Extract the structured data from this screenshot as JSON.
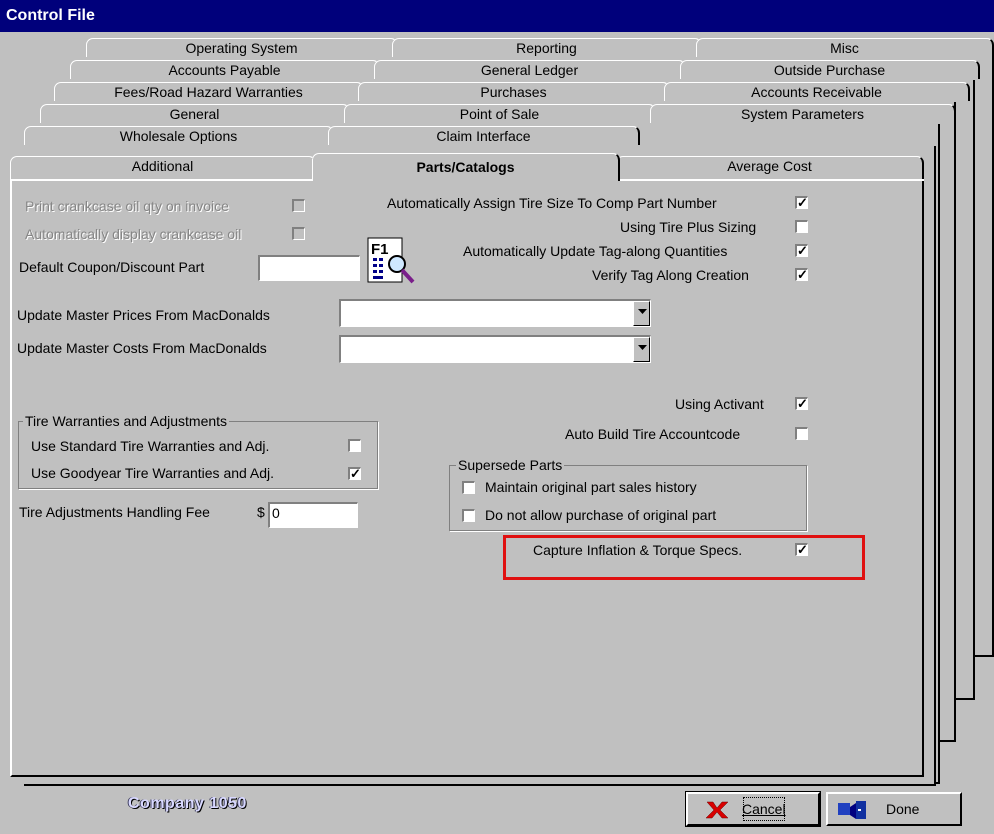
{
  "window": {
    "title": "Control File"
  },
  "tabs": {
    "row1": [
      "Operating System",
      "Reporting",
      "Misc"
    ],
    "row2": [
      "Accounts Payable",
      "General Ledger",
      "Outside Purchase"
    ],
    "row3": [
      "Fees/Road Hazard Warranties",
      "Purchases",
      "Accounts Receivable"
    ],
    "row4": [
      "General",
      "Point of Sale",
      "System Parameters"
    ],
    "row5": [
      "Wholesale Options",
      "Claim Interface"
    ],
    "row6": [
      "Additional",
      "Parts/Catalogs",
      "Average Cost"
    ],
    "selected": "Parts/Catalogs"
  },
  "left": {
    "print_crankcase": {
      "label": "Print crankcase oil qty on invoice",
      "checked": false,
      "disabled": true
    },
    "auto_display_crankcase": {
      "label": "Automatically display crankcase oil",
      "checked": false,
      "disabled": true
    },
    "default_coupon": {
      "label": "Default Coupon/Discount Part",
      "value": ""
    },
    "f1_button_icon": "f1-search-icon"
  },
  "right": {
    "auto_assign_tire_size": {
      "label": "Automatically Assign Tire Size To Comp Part Number",
      "checked": true
    },
    "using_tire_plus": {
      "label": "Using Tire Plus Sizing",
      "checked": false
    },
    "auto_update_tagalong": {
      "label": "Automatically Update Tag-along Quantities",
      "checked": true
    },
    "verify_tagalong": {
      "label": "Verify Tag Along Creation",
      "checked": true
    }
  },
  "macdonalds": {
    "prices_label": "Update Master Prices From MacDonalds",
    "prices_value": "",
    "costs_label": "Update Master Costs From MacDonalds",
    "costs_value": ""
  },
  "activant": {
    "using_activant": {
      "label": "Using Activant",
      "checked": true
    },
    "auto_build_tire": {
      "label": "Auto Build Tire Accountcode",
      "checked": false
    }
  },
  "tire_warranties": {
    "title": "Tire Warranties and Adjustments",
    "standard": {
      "label": "Use Standard Tire Warranties and Adj.",
      "checked": false
    },
    "goodyear": {
      "label": "Use Goodyear Tire Warranties and Adj.",
      "checked": true
    }
  },
  "handling_fee": {
    "label": "Tire Adjustments Handling Fee",
    "currency": "$",
    "value": "0"
  },
  "supersede": {
    "title": "Supersede Parts",
    "maintain_history": {
      "label": "Maintain original part sales history",
      "checked": false
    },
    "no_purchase": {
      "label": "Do not allow purchase of original part",
      "checked": false
    }
  },
  "capture_inflation": {
    "label": "Capture Inflation & Torque Specs.",
    "checked": true
  },
  "footer": {
    "company": "Company 1050",
    "cancel_label": "Cancel",
    "done_label": "Done"
  },
  "colors": {
    "title_bg": "#00007b",
    "face": "#c0c0c0",
    "highlight_box": "#e01010"
  }
}
